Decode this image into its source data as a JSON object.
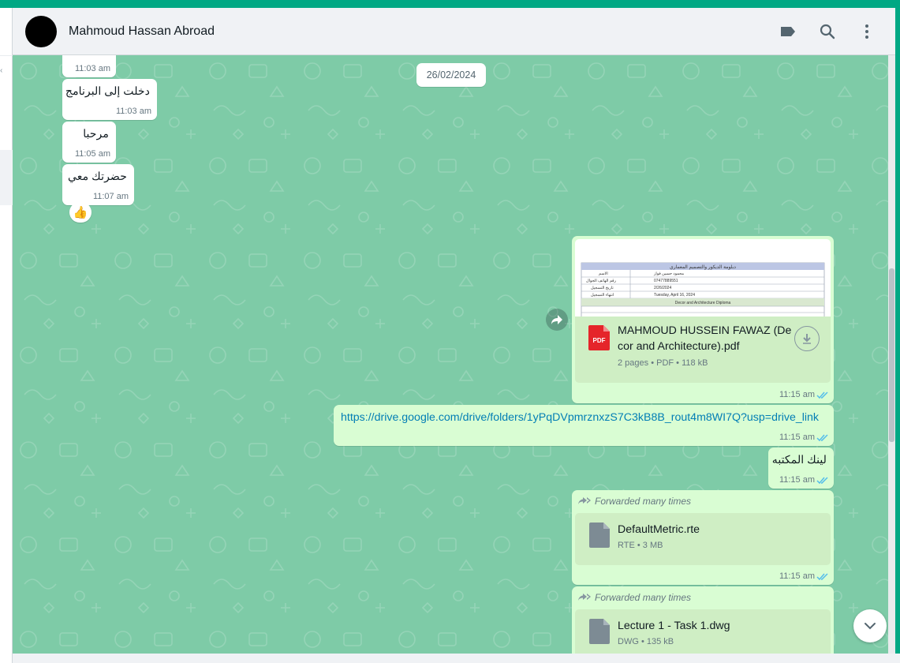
{
  "header": {
    "contact_name": "Mahmoud Hassan Abroad"
  },
  "chat": {
    "date_chip": "26/02/2024",
    "incoming": [
      {
        "text": "",
        "time": "11:03 am"
      },
      {
        "text": "دخلت إلى البرنامج",
        "time": "11:03 am"
      },
      {
        "text": "مرحبا",
        "time": "11:05 am"
      },
      {
        "text": "حضرتك معي",
        "time": "11:07 am",
        "reaction": "👍"
      }
    ],
    "pdf_message": {
      "file_name_line1": "MAHMOUD HUSSEIN FAWAZ (De",
      "file_name_line2": "cor and Architecture).pdf",
      "meta": "2 pages • PDF • 118 kB",
      "icon_label": "PDF",
      "time": "11:15 am",
      "thumb_title": "دبلومة الديكور والتصميم المعماري",
      "thumb_rows": [
        {
          "label": "الاسم",
          "value": "محمود حسين فواز"
        },
        {
          "label": "رقم الهاتف الجوال",
          "value": "07477889551"
        },
        {
          "label": "تاريخ التسجيل",
          "value": "2/26/2024"
        },
        {
          "label": "انتهاء التسجيل",
          "value": "Tuesday, April 16, 2024"
        }
      ],
      "thumb_section": "Decor and Architecture Diploma"
    },
    "link_message": {
      "url": "https://drive.google.com/drive/folders/1yPqDVpmrznxzS7C3kB8B_rout4m8WI7Q?usp=drive_link",
      "time": "11:15 am"
    },
    "library_message": {
      "text": "لينك المكتبه",
      "time": "11:15 am"
    },
    "file_messages": [
      {
        "forwarded": "Forwarded many times",
        "name": "DefaultMetric.rte",
        "meta": "RTE • 3 MB",
        "time": "11:15 am"
      },
      {
        "forwarded": "Forwarded many times",
        "name": "Lecture 1 - Task 1.dwg",
        "meta": "DWG • 135 kB"
      }
    ]
  },
  "colors": {
    "accent": "#00a884",
    "wallpaper": "#7ecba7",
    "outgoing_bubble": "#d9fdd3",
    "incoming_bubble": "#ffffff",
    "read_ticks": "#53bdeb",
    "pdf_red": "#e5252a"
  },
  "icons": {
    "header": [
      "label-icon",
      "search-icon",
      "menu-icon"
    ],
    "files": [
      "pdf-icon",
      "file-icon",
      "download-icon",
      "forward-icon",
      "chevron-down-icon"
    ]
  }
}
